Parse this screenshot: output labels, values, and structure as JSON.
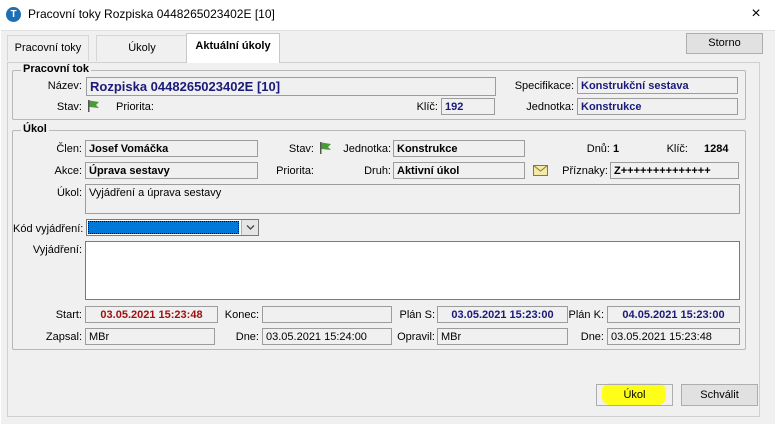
{
  "window": {
    "title": "Pracovní toky Rozpiska 0448265023402E [10]",
    "icon": "app-logo-icon",
    "close": "×"
  },
  "tabs": [
    "Pracovní toky",
    "Úkoly",
    "Aktuální úkoly"
  ],
  "storno": "Storno",
  "pracovni_tok": {
    "title": "Pracovní tok",
    "nazev_label": "Název:",
    "nazev": "Rozpiska 0448265023402E [10]",
    "specifikace_label": "Specifikace:",
    "specifikace": "Konstrukční sestava",
    "stav_label": "Stav:",
    "priorita_label": "Priorita:",
    "klic_label": "Klíč:",
    "klic": "192",
    "jednotka_label": "Jednotka:",
    "jednotka": "Konstrukce"
  },
  "ukol": {
    "title": "Úkol",
    "clen_label": "Člen:",
    "clen": "Josef Vomáčka",
    "stav_label": "Stav:",
    "jednotka_label": "Jednotka:",
    "jednotka": "Konstrukce",
    "dnu_label": "Dnů:",
    "dnu": "1",
    "klic_label": "Klíč:",
    "klic": "1284",
    "akce_label": "Akce:",
    "akce": "Úprava sestavy",
    "priorita_label": "Priorita:",
    "druh_label": "Druh:",
    "druh": "Aktivní úkol",
    "priznaky_label": "Příznaky:",
    "priznaky": "Z++++++++++++++",
    "ukol_label": "Úkol:",
    "ukol_text": "Vyjádření a úprava sestavy",
    "kod_label": "Kód vyjádření:",
    "vyjadreni_label": "Vyjádření:",
    "start_label": "Start:",
    "start": "03.05.2021 15:23:48",
    "konec_label": "Konec:",
    "konec": "",
    "plan_s_label": "Plán S:",
    "plan_s": "03.05.2021 15:23:00",
    "plan_k_label": "Plán K:",
    "plan_k": "04.05.2021 15:23:00",
    "zapsal_label": "Zapsal:",
    "zapsal": "MBr",
    "dne1_label": "Dne:",
    "dne1": "03.05.2021 15:24:00",
    "opravil_label": "Opravil:",
    "opravil": "MBr",
    "dne2_label": "Dne:",
    "dne2": "03.05.2021 15:23:48"
  },
  "buttons": {
    "ukol": "Úkol",
    "schvalit": "Schválit"
  },
  "colors": {
    "flag": "#4a9a3a",
    "highlight": "#ffff00",
    "selection": "#0078d7"
  }
}
